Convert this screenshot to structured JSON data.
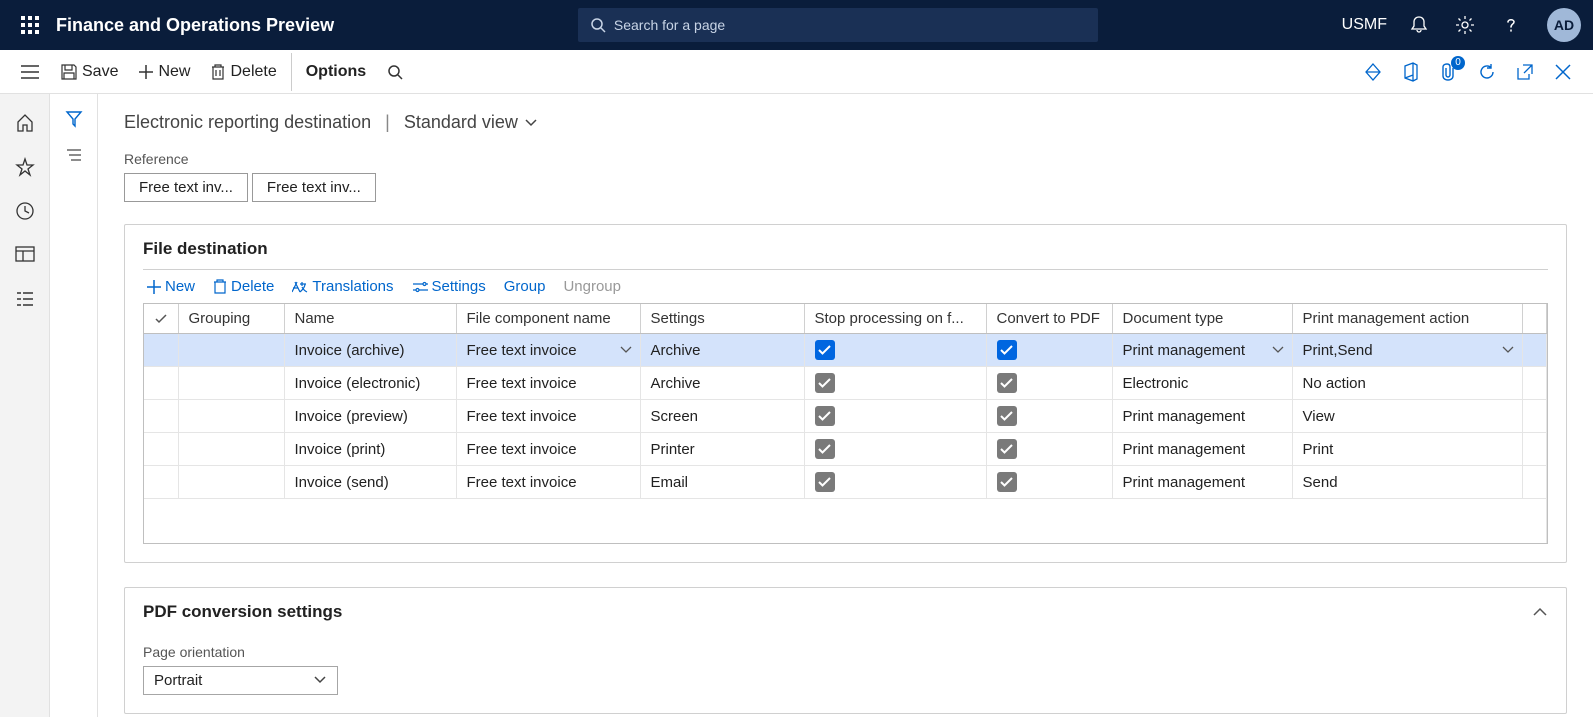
{
  "top": {
    "app_title": "Finance and Operations Preview",
    "search_placeholder": "Search for a page",
    "org": "USMF",
    "avatar": "AD"
  },
  "actionpane": {
    "save": "Save",
    "new": "New",
    "delete": "Delete",
    "options": "Options",
    "attach_count": "0"
  },
  "breadcrumb": {
    "title": "Electronic reporting destination",
    "view": "Standard view"
  },
  "reference": {
    "label": "Reference",
    "chips": [
      "Free text inv...",
      "Free text inv..."
    ]
  },
  "file_destination": {
    "title": "File destination",
    "toolbar": {
      "new": "New",
      "delete": "Delete",
      "translations": "Translations",
      "settings": "Settings",
      "group": "Group",
      "ungroup": "Ungroup"
    },
    "columns": [
      "Grouping",
      "Name",
      "File component name",
      "Settings",
      "Stop processing on f...",
      "Convert to PDF",
      "Document type",
      "Print management action"
    ],
    "rows": [
      {
        "selected": true,
        "grouping": "",
        "name": "Invoice (archive)",
        "component": "Free text invoice",
        "settings": "Archive",
        "stop": true,
        "pdf": true,
        "doctype": "Print management",
        "action": "Print,Send"
      },
      {
        "selected": false,
        "grouping": "",
        "name": "Invoice (electronic)",
        "component": "Free text invoice",
        "settings": "Archive",
        "stop": true,
        "pdf": true,
        "doctype": "Electronic",
        "action": "No action"
      },
      {
        "selected": false,
        "grouping": "",
        "name": "Invoice (preview)",
        "component": "Free text invoice",
        "settings": "Screen",
        "stop": true,
        "pdf": true,
        "doctype": "Print management",
        "action": "View"
      },
      {
        "selected": false,
        "grouping": "",
        "name": "Invoice (print)",
        "component": "Free text invoice",
        "settings": "Printer",
        "stop": true,
        "pdf": true,
        "doctype": "Print management",
        "action": "Print"
      },
      {
        "selected": false,
        "grouping": "",
        "name": "Invoice (send)",
        "component": "Free text invoice",
        "settings": "Email",
        "stop": true,
        "pdf": true,
        "doctype": "Print management",
        "action": "Send"
      }
    ]
  },
  "pdf_settings": {
    "title": "PDF conversion settings",
    "page_orientation_label": "Page orientation",
    "page_orientation_value": "Portrait"
  }
}
